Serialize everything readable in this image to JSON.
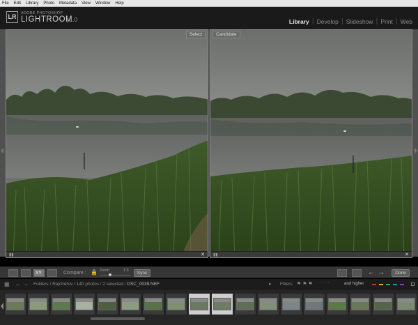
{
  "menu": [
    "File",
    "Edit",
    "Library",
    "Photo",
    "Metadata",
    "View",
    "Window",
    "Help"
  ],
  "app": {
    "logo": "LR",
    "brand_small": "ADOBE PHOTOSHOP",
    "brand_big": "LIGHTROOM",
    "version": "1.0"
  },
  "modules": [
    {
      "label": "Library",
      "active": true
    },
    {
      "label": "Develop",
      "active": false
    },
    {
      "label": "Slideshow",
      "active": false
    },
    {
      "label": "Print",
      "active": false
    },
    {
      "label": "Web",
      "active": false
    }
  ],
  "compare": {
    "select_label": "Select",
    "candidate_label": "Candidate",
    "close_glyph": "✕"
  },
  "toolbar": {
    "xy_label": "XY",
    "compare_label": "Compare :",
    "zoom_label": "Zoom",
    "zoom_value": "1:3",
    "sync_label": "Sync",
    "done_label": "Done"
  },
  "filmstrip_header": {
    "path_prefix": "Folders / Rajchéřov / 140 photos / 2 selected / ",
    "filename": "DSC_0039.NEF",
    "filters_label": "Filters",
    "rating_filter": "and higher"
  },
  "colors": {
    "flags": [
      "#c0392b",
      "#d4ac0d",
      "#27ae60",
      "#2e86c1",
      "#8e44ad"
    ]
  },
  "thumbnails": [
    {
      "tone": "#6b7a5a",
      "selected": false
    },
    {
      "tone": "#8a9a7a",
      "selected": false
    },
    {
      "tone": "#5d7a4c",
      "selected": false
    },
    {
      "tone": "#a8b0a0",
      "selected": false
    },
    {
      "tone": "#4f5f3e",
      "selected": false
    },
    {
      "tone": "#8c9c80",
      "selected": false
    },
    {
      "tone": "#5a7048",
      "selected": false
    },
    {
      "tone": "#7f8f72",
      "selected": false
    },
    {
      "tone": "#6a7a62",
      "selected": true
    },
    {
      "tone": "#6d7d64",
      "selected": true
    },
    {
      "tone": "#5f6f55",
      "selected": false
    },
    {
      "tone": "#818f78",
      "selected": false
    },
    {
      "tone": "#7b858a",
      "selected": false
    },
    {
      "tone": "#70787d",
      "selected": false
    },
    {
      "tone": "#5b7a48",
      "selected": false
    },
    {
      "tone": "#687a5a",
      "selected": false
    },
    {
      "tone": "#55654a",
      "selected": false
    },
    {
      "tone": "#7d8a72",
      "selected": false
    }
  ]
}
